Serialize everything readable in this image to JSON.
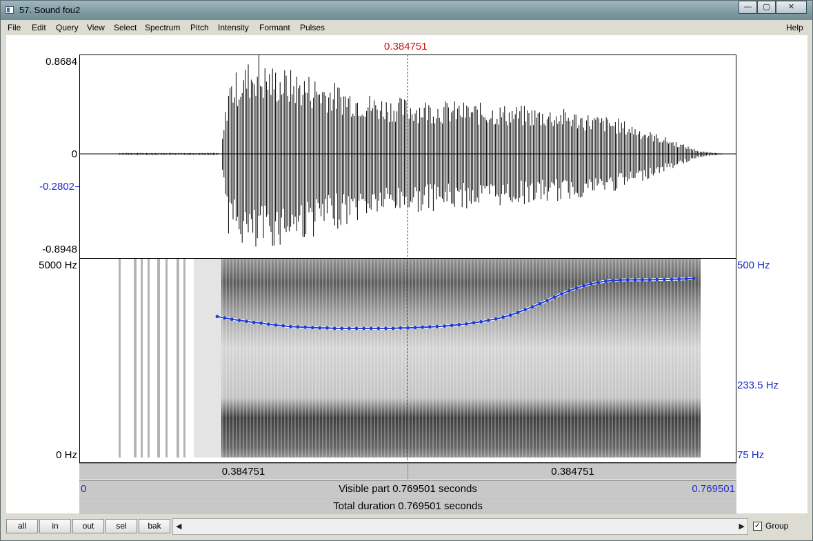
{
  "window": {
    "title": "57. Sound fou2",
    "buttons": [
      "—",
      "▢",
      "✕"
    ]
  },
  "menu": {
    "items": [
      "File",
      "Edit",
      "Query",
      "View",
      "Select",
      "Spectrum",
      "Pitch",
      "Intensity",
      "Formant",
      "Pulses"
    ],
    "help": "Help"
  },
  "cursor": {
    "time_label": "0.384751"
  },
  "waveform": {
    "max_label": "0.8684",
    "zero_label": "0",
    "cursor_value_label": "-0.2802",
    "min_label": "-0.8948"
  },
  "spectrogram": {
    "top_label": "5000 Hz",
    "bottom_label": "0 Hz"
  },
  "pitch": {
    "top_label": "500 Hz",
    "cursor_label": "233.5 Hz",
    "bottom_label": "75 Hz",
    "color": "#1f3bd6",
    "contour_hz": [
      294,
      290,
      286,
      283,
      280,
      277,
      275,
      272,
      270,
      268,
      266,
      265,
      264,
      263,
      262,
      262,
      261,
      261,
      261,
      261,
      261,
      261,
      261,
      261,
      261,
      262,
      262,
      263,
      264,
      265,
      266,
      267,
      269,
      271,
      273,
      276,
      279,
      283,
      287,
      292,
      298,
      306,
      315,
      324,
      334,
      345,
      357,
      369,
      381,
      391,
      400,
      408,
      414,
      419,
      422,
      424,
      425,
      425,
      425,
      425,
      426,
      426,
      427,
      428,
      429,
      431
    ]
  },
  "time_rows": {
    "left_segment": "0.384751",
    "right_segment": "0.384751",
    "visible_start": "0",
    "visible_text": "Visible part 0.769501 seconds",
    "visible_end": "0.769501",
    "total_text": "Total duration 0.769501 seconds"
  },
  "bottom": {
    "buttons": [
      "all",
      "in",
      "out",
      "sel",
      "bak"
    ],
    "group_label": "Group",
    "group_checked": true
  }
}
